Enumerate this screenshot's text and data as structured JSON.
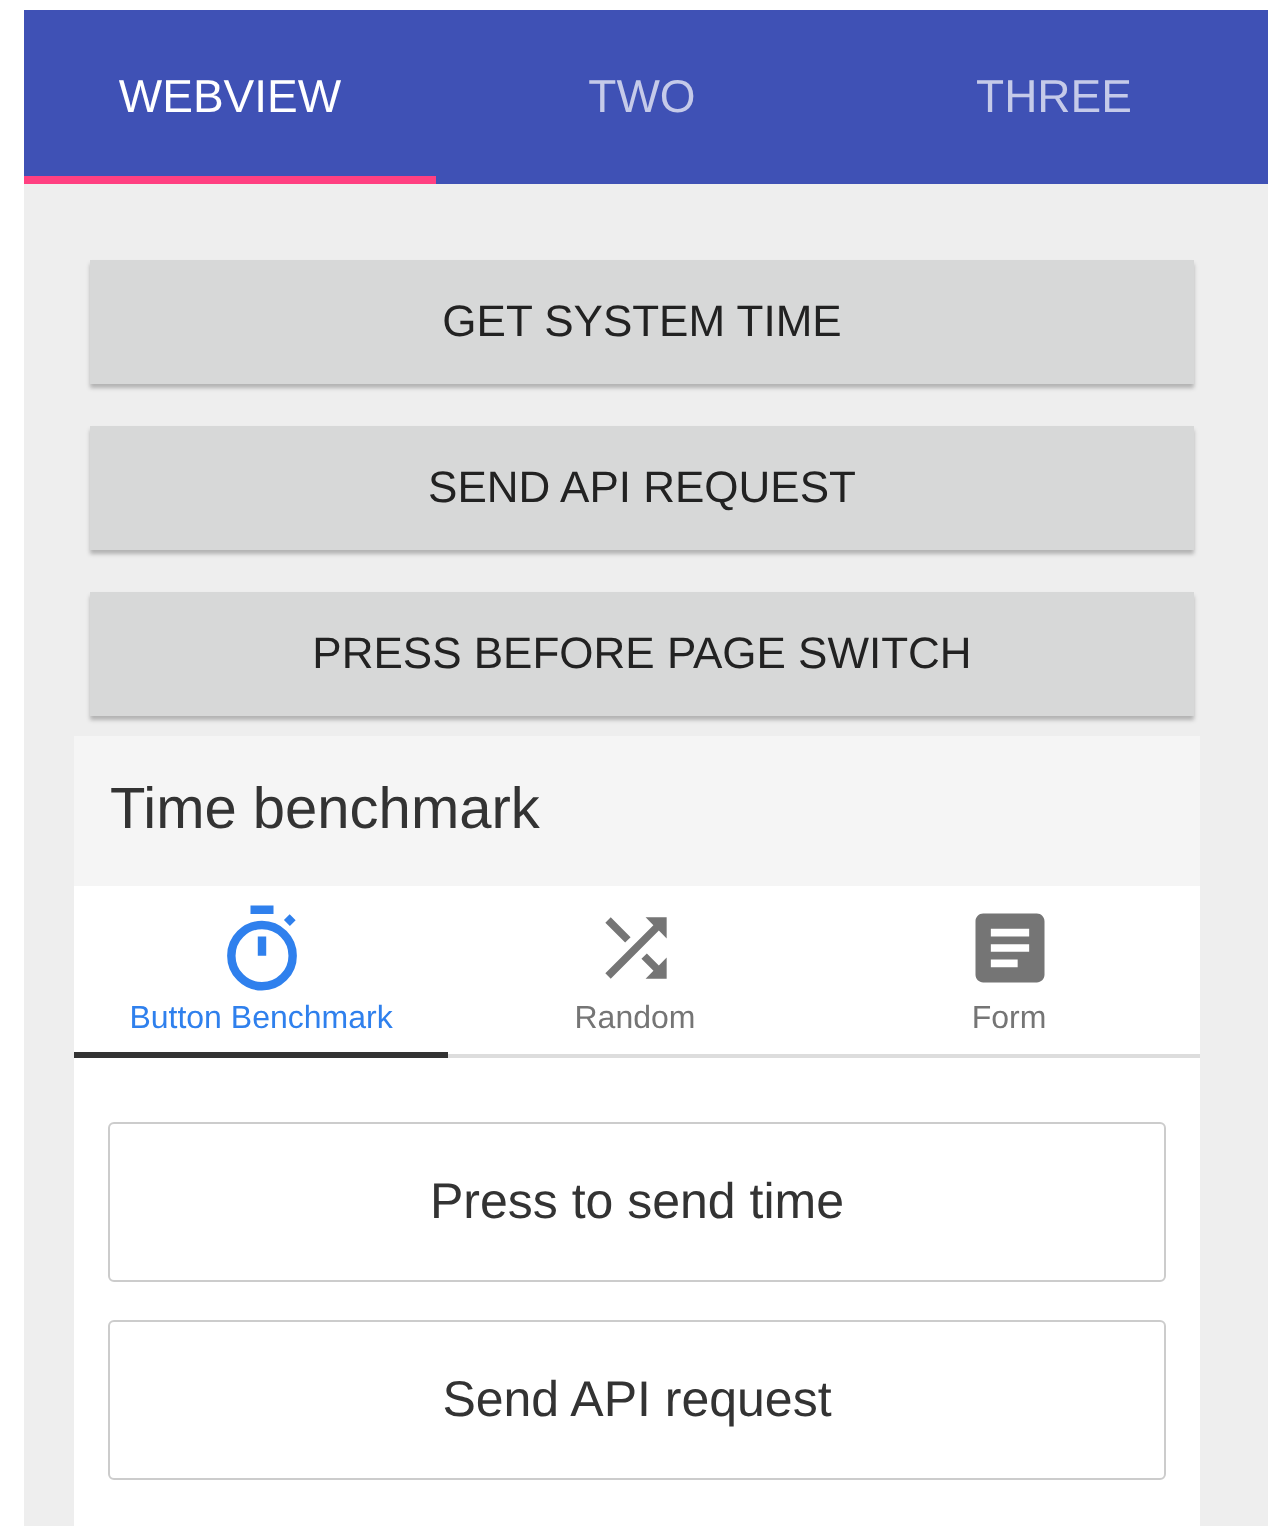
{
  "tabs": [
    {
      "label": "WEBVIEW",
      "selected": true
    },
    {
      "label": "TWO",
      "selected": false
    },
    {
      "label": "THREE",
      "selected": false
    }
  ],
  "buttons": [
    "GET SYSTEM TIME",
    "SEND API REQUEST",
    "PRESS BEFORE PAGE SWITCH"
  ],
  "card": {
    "title": "Time benchmark",
    "tabs": [
      {
        "label": "Button Benchmark",
        "kind": "timer",
        "selected": true
      },
      {
        "label": "Random",
        "kind": "random",
        "selected": false
      },
      {
        "label": "Form",
        "kind": "form",
        "selected": false
      }
    ],
    "buttons": [
      "Press to send time",
      "Send API request"
    ]
  }
}
